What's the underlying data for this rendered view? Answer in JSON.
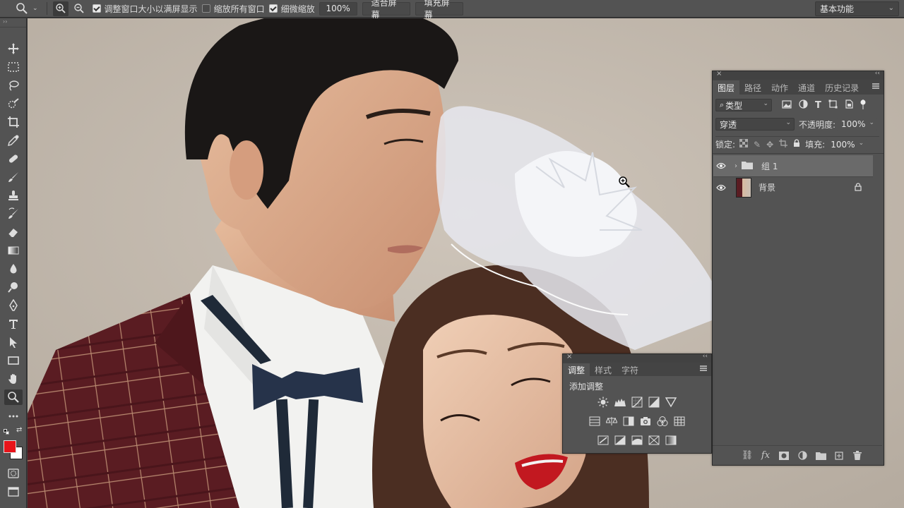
{
  "options_bar": {
    "zoom_in_label": "+",
    "zoom_out_label": "−",
    "resize_windows_label": "调整窗口大小以满屏显示",
    "zoom_all_label": "缩放所有窗口",
    "scrubby_zoom_label": "细微缩放",
    "zoom_value": "100%",
    "fit_screen_label": "适合屏幕",
    "fill_screen_label": "填充屏幕",
    "workspace_label": "基本功能"
  },
  "toolbar": {
    "expand_label": "››",
    "colors": {
      "foreground": "#e8141a",
      "background": "#ffffff"
    }
  },
  "layers_panel": {
    "tabs": [
      "图层",
      "路径",
      "动作",
      "通道",
      "历史记录"
    ],
    "filter_label": "类型",
    "blend_mode": "穿透",
    "opacity_label": "不透明度:",
    "opacity_value": "100%",
    "lock_label": "锁定:",
    "fill_label": "填充:",
    "fill_value": "100%",
    "layers": [
      {
        "name": "组 1",
        "type": "group"
      },
      {
        "name": "背景",
        "type": "image"
      }
    ]
  },
  "adjustments_panel": {
    "tabs": [
      "调整",
      "样式",
      "字符"
    ],
    "title": "添加调整"
  }
}
